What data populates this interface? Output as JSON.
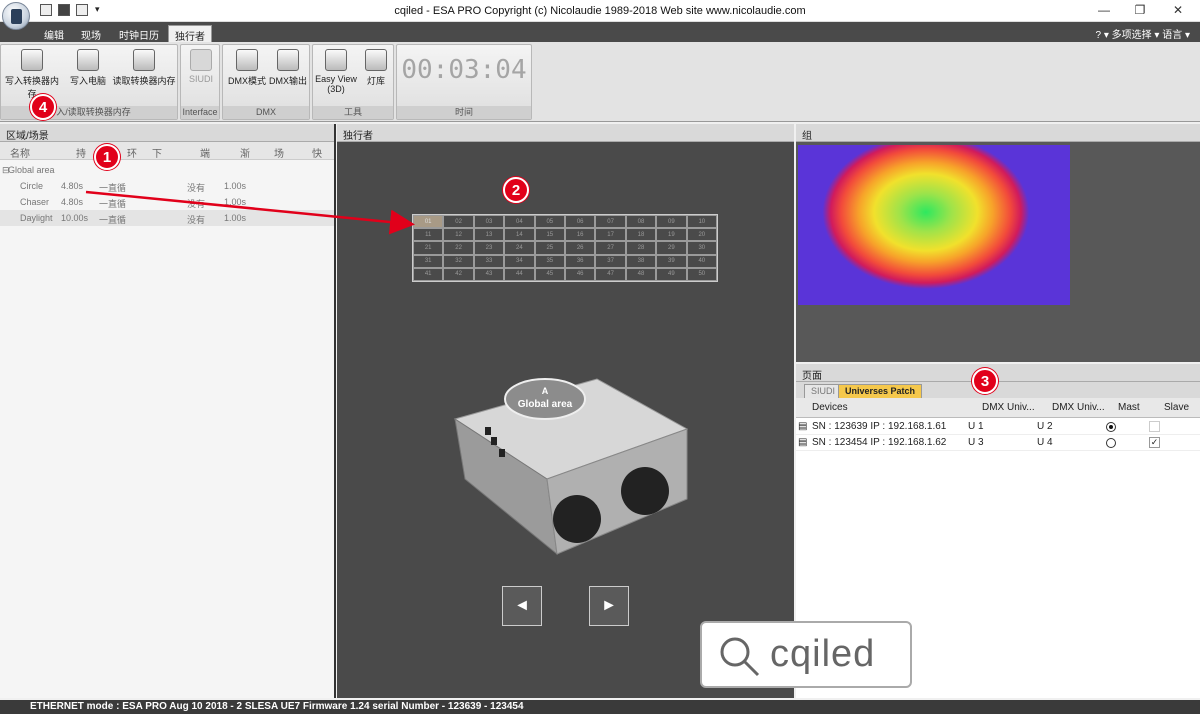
{
  "window": {
    "title": "cqiled - ESA PRO   Copyright (c) Nicolaudie 1989-2018   Web site www.nicolaudie.com",
    "controls": [
      "—",
      "❐",
      "✕"
    ]
  },
  "menu": {
    "tabs": [
      "编辑",
      "现场",
      "时钟日历",
      "独行者"
    ],
    "active_tab": "独行者",
    "right": "?  ▾ 多项选择 ▾ 语言 ▾"
  },
  "ribbon": {
    "groups": [
      {
        "label": "写入/读取转换器内存",
        "buttons": [
          "写入转换器内存",
          "写入电脑",
          "读取转换器内存"
        ]
      },
      {
        "label": "Interface",
        "buttons": [
          "SIUDI"
        ]
      },
      {
        "label": "DMX",
        "buttons": [
          "DMX模式",
          "DMX输出"
        ]
      },
      {
        "label": "工具",
        "buttons": [
          "Easy View (3D)",
          "灯库"
        ]
      },
      {
        "label": "时间",
        "buttons": []
      }
    ],
    "timer": "00:03:04"
  },
  "left_panel": {
    "title": "区域/场景",
    "columns": [
      "名称",
      "持",
      "环",
      "下",
      "端",
      "渐",
      "场",
      "快"
    ],
    "root": "Global area",
    "rows": [
      {
        "name": "Circle",
        "time": "4.80s",
        "loop": "一直循",
        "next": "没有",
        "fade": "1.00s"
      },
      {
        "name": "Chaser",
        "time": "4.80s",
        "loop": "一直循",
        "next": "没有",
        "fade": "1.00s"
      },
      {
        "name": "Daylight",
        "time": "10.00s",
        "loop": "一直循",
        "next": "没有",
        "fade": "1.00s"
      }
    ]
  },
  "mid_panel": {
    "title": "独行者",
    "selected_cell": "01",
    "device_label_a": "A",
    "device_label_b": "Global area",
    "prev": "◄",
    "next": "►"
  },
  "right_top": {
    "title": "组"
  },
  "right_bottom": {
    "title": "页面",
    "tabs": [
      "SIUDI",
      "Universes Patch"
    ],
    "active_tab": "Universes Patch",
    "columns": [
      "Devices",
      "DMX Univ...",
      "DMX Univ...",
      "Mast",
      "Slave"
    ],
    "rows": [
      {
        "device": "SN : 123639   IP : 192.168.1.61",
        "u1": "U 1",
        "u2": "U 2",
        "master": true,
        "slave": false
      },
      {
        "device": "SN : 123454   IP : 192.168.1.62",
        "u1": "U 3",
        "u2": "U 4",
        "master": false,
        "slave": true
      }
    ]
  },
  "status": "ETHERNET mode : ESA PRO Aug 10 2018 - 2 SLESA UE7 Firmware 1.24 serial Number  - 123639 - 123454",
  "annotations": [
    "1",
    "2",
    "3",
    "4"
  ],
  "watermark": "cqiled",
  "colors": {
    "accent": "#e1001a",
    "dark_bg": "#4a4a4a",
    "tab_active": "#f5c84c"
  }
}
